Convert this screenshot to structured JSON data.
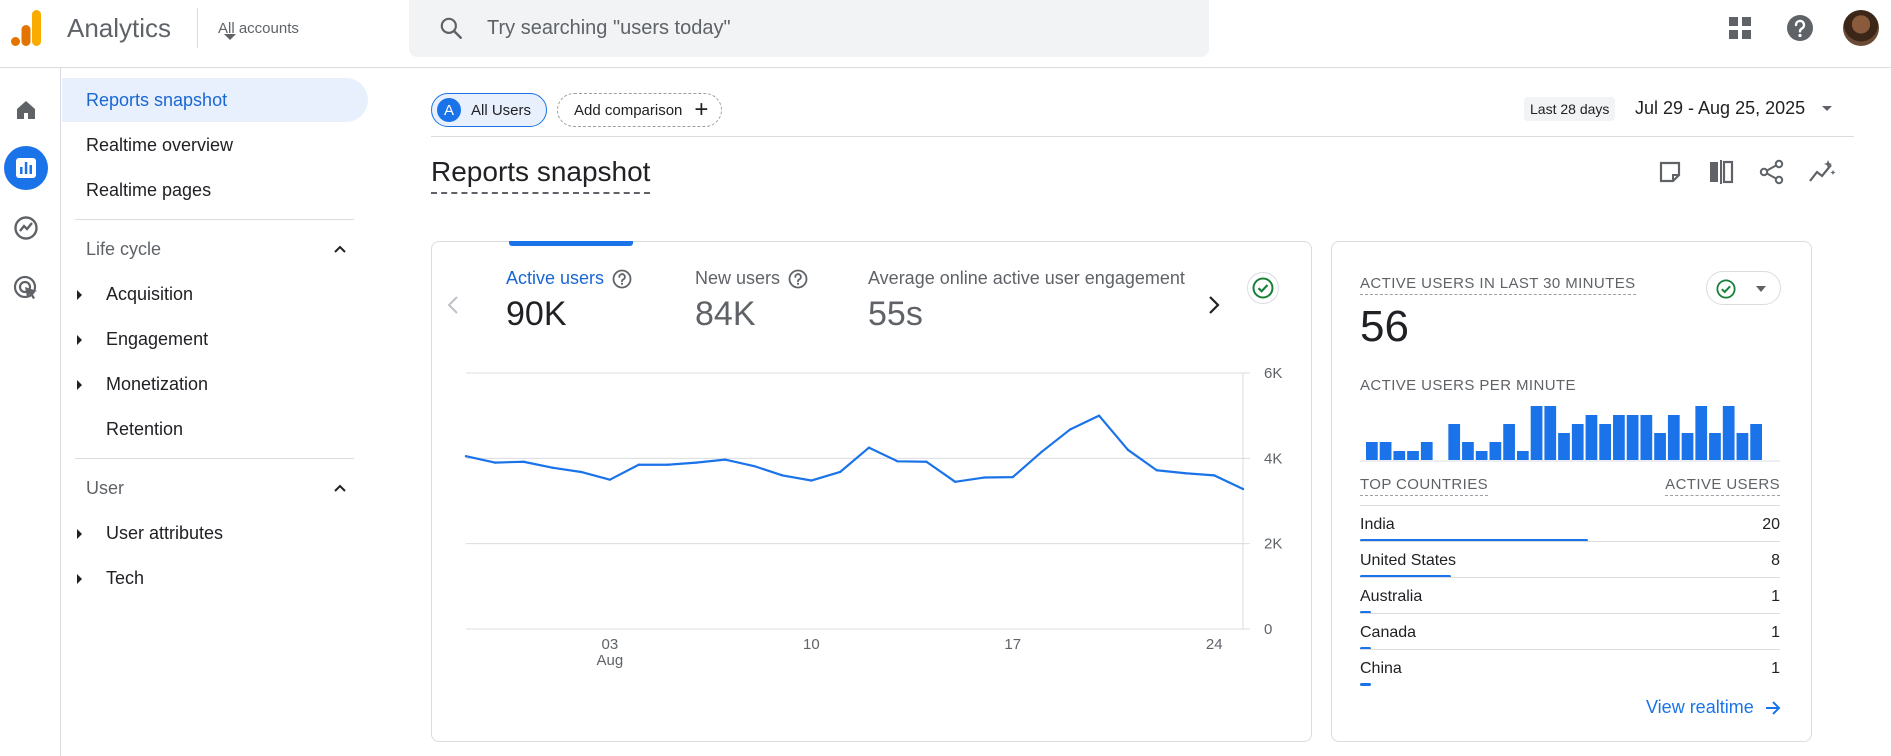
{
  "app": {
    "title": "Analytics",
    "account_label": "All accounts"
  },
  "search": {
    "placeholder": "Try searching \"users today\""
  },
  "nav": {
    "items": [
      {
        "label": "Reports snapshot"
      },
      {
        "label": "Realtime overview"
      },
      {
        "label": "Realtime pages"
      }
    ],
    "lifecycle": {
      "label": "Life cycle",
      "items": [
        {
          "label": "Acquisition"
        },
        {
          "label": "Engagement"
        },
        {
          "label": "Monetization"
        },
        {
          "label": "Retention"
        }
      ]
    },
    "user": {
      "label": "User",
      "items": [
        {
          "label": "User attributes"
        },
        {
          "label": "Tech"
        }
      ]
    }
  },
  "header": {
    "segment_badge": "A",
    "segment_label": "All Users",
    "add_comparison": "Add comparison",
    "date_badge": "Last 28 days",
    "date_range": "Jul 29 - Aug 25, 2025",
    "page_title": "Reports snapshot"
  },
  "metrics": [
    {
      "label": "Active users",
      "value": "90K"
    },
    {
      "label": "New users",
      "value": "84K"
    },
    {
      "label": "Average online active user engagement",
      "value": "55s"
    }
  ],
  "chart_data": {
    "type": "line",
    "series": [
      {
        "values": [
          4050,
          3900,
          3920,
          3780,
          3680,
          3500,
          3850,
          3850,
          3900,
          3970,
          3820,
          3600,
          3480,
          3680,
          4250,
          3930,
          3920,
          3450,
          3550,
          3560,
          4150,
          4680,
          5000,
          4200,
          3720,
          3650,
          3600,
          3280
        ]
      }
    ],
    "x": [
      "Jul 29",
      "Jul 30",
      "Jul 31",
      "Aug 1",
      "Aug 2",
      "Aug 3",
      "Aug 4",
      "Aug 5",
      "Aug 6",
      "Aug 7",
      "Aug 8",
      "Aug 9",
      "Aug 10",
      "Aug 11",
      "Aug 12",
      "Aug 13",
      "Aug 14",
      "Aug 15",
      "Aug 16",
      "Aug 17",
      "Aug 18",
      "Aug 19",
      "Aug 20",
      "Aug 21",
      "Aug 22",
      "Aug 23",
      "Aug 24",
      "Aug 25"
    ],
    "xticks": [
      {
        "index": 5,
        "label": "03",
        "sublabel": "Aug"
      },
      {
        "index": 12,
        "label": "10",
        "sublabel": ""
      },
      {
        "index": 19,
        "label": "17",
        "sublabel": ""
      },
      {
        "index": 26,
        "label": "24",
        "sublabel": ""
      }
    ],
    "yticks": [
      "0",
      "2K",
      "4K",
      "6K"
    ],
    "ylim": [
      0,
      6000
    ],
    "grid": true,
    "color": "#1a73e8"
  },
  "realtime": {
    "title": "ACTIVE USERS IN LAST 30 MINUTES",
    "value": "56",
    "per_minute_label": "ACTIVE USERS PER MINUTE",
    "per_minute_chart": {
      "type": "bar",
      "values": [
        1,
        1,
        0.5,
        0.5,
        1,
        0,
        2,
        1,
        0.5,
        1,
        2,
        0.5,
        3,
        3,
        1.5,
        2,
        2.5,
        2,
        2.5,
        2.5,
        2.5,
        1.5,
        2.5,
        1.5,
        3,
        1.5,
        3,
        1.5,
        2
      ],
      "color": "#1a73e8"
    },
    "table": {
      "col1": "TOP COUNTRIES",
      "col2": "ACTIVE USERS",
      "rows": [
        {
          "country": "India",
          "users": "20",
          "share": 1.0
        },
        {
          "country": "United States",
          "users": "8",
          "share": 0.4
        },
        {
          "country": "Australia",
          "users": "1",
          "share": 0.05
        },
        {
          "country": "Canada",
          "users": "1",
          "share": 0.05
        },
        {
          "country": "China",
          "users": "1",
          "share": 0.05
        }
      ]
    },
    "view_link": "View realtime"
  },
  "colors": {
    "accent": "#1a73e8",
    "success": "#188038",
    "logo_orange": "#f9ab00",
    "logo_dark": "#e37400"
  }
}
